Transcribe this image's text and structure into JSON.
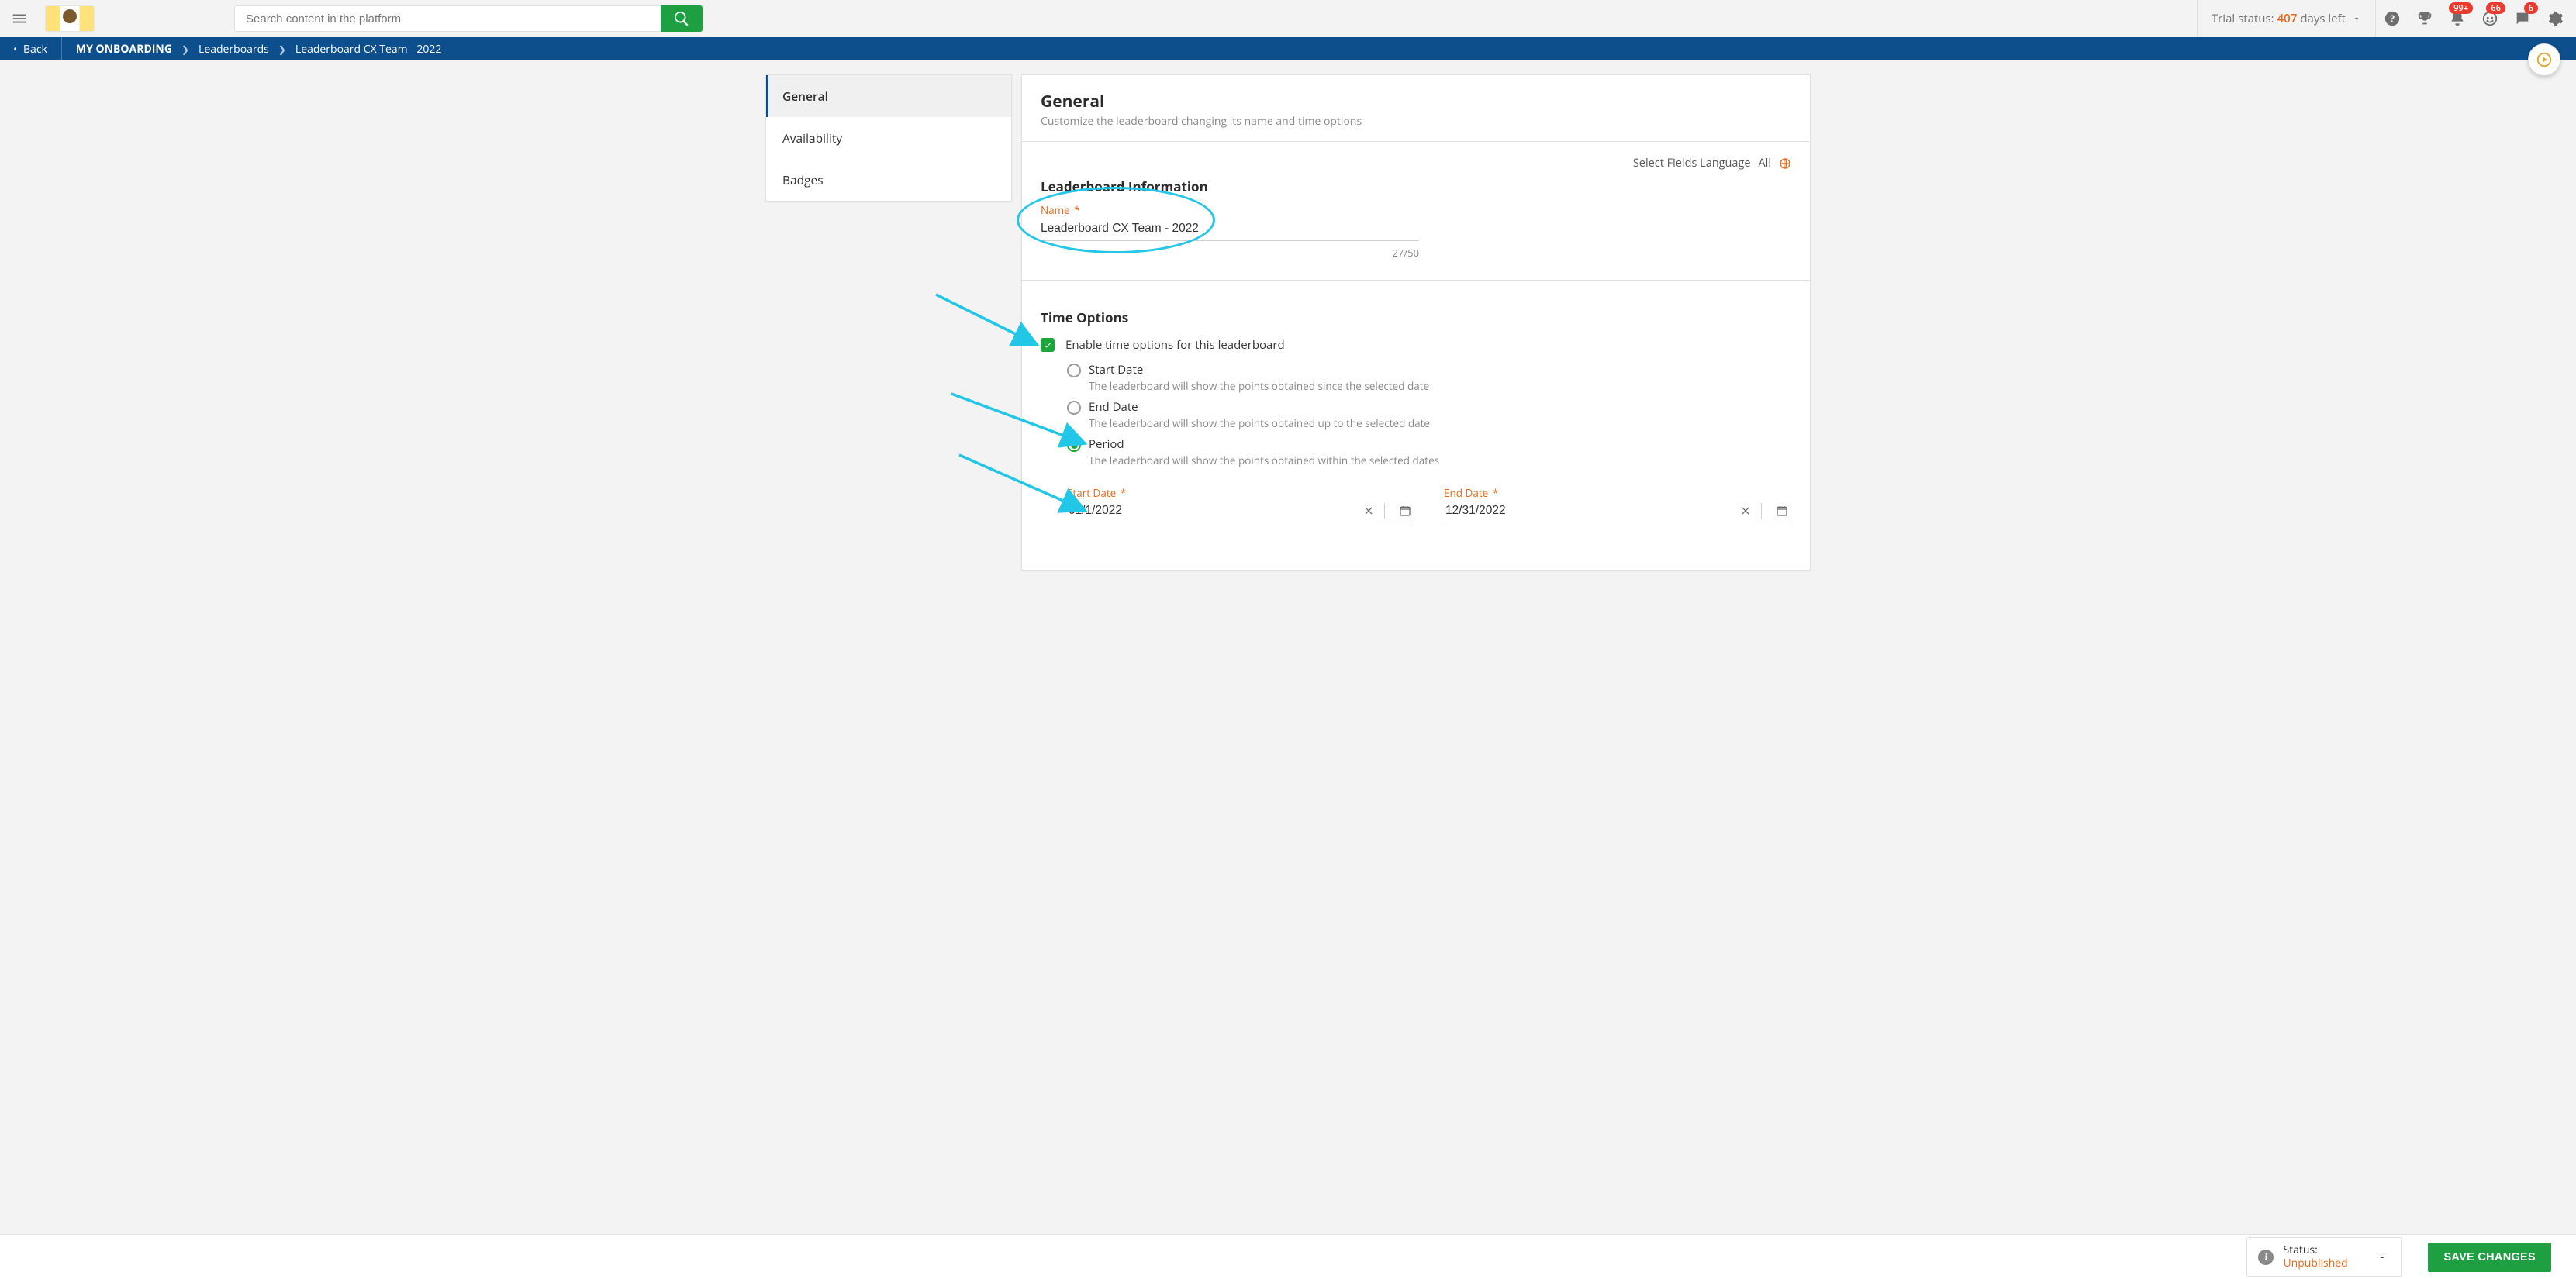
{
  "header": {
    "search_placeholder": "Search content in the platform",
    "trial": {
      "prefix": "Trial status:",
      "days": "407",
      "suffix": "days left"
    },
    "badges": {
      "notif": "99+",
      "coins": "66",
      "chat": "6"
    }
  },
  "breadcrumb": {
    "back": "Back",
    "items": [
      "MY ONBOARDING",
      "Leaderboards",
      "Leaderboard CX Team - 2022"
    ]
  },
  "sidenav": {
    "items": [
      {
        "label": "General",
        "active": true
      },
      {
        "label": "Availability",
        "active": false
      },
      {
        "label": "Badges",
        "active": false
      }
    ]
  },
  "main": {
    "title": "General",
    "subtitle": "Customize the leaderboard changing its name and time options",
    "lang": {
      "label": "Select Fields Language",
      "value": "All"
    },
    "info": {
      "heading": "Leaderboard Information",
      "name_label": "Name",
      "name_value": "Leaderboard CX Team - 2022",
      "char_count": "27/50"
    },
    "time": {
      "heading": "Time Options",
      "enable_label": "Enable time options for this leaderboard",
      "enable_checked": true,
      "radios": [
        {
          "key": "start",
          "label": "Start Date",
          "desc": "The leaderboard will show the points obtained since the selected date",
          "selected": false
        },
        {
          "key": "end",
          "label": "End Date",
          "desc": "The leaderboard will show the points obtained up to the selected date",
          "selected": false
        },
        {
          "key": "period",
          "label": "Period",
          "desc": "The leaderboard will show the points obtained within the selected dates",
          "selected": true
        }
      ],
      "start_date": {
        "label": "Start Date",
        "value": "01/1/2022"
      },
      "end_date": {
        "label": "End Date",
        "value": "12/31/2022"
      }
    }
  },
  "footer": {
    "status_label": "Status:",
    "status_value": "Unpublished",
    "save": "SAVE CHANGES"
  }
}
